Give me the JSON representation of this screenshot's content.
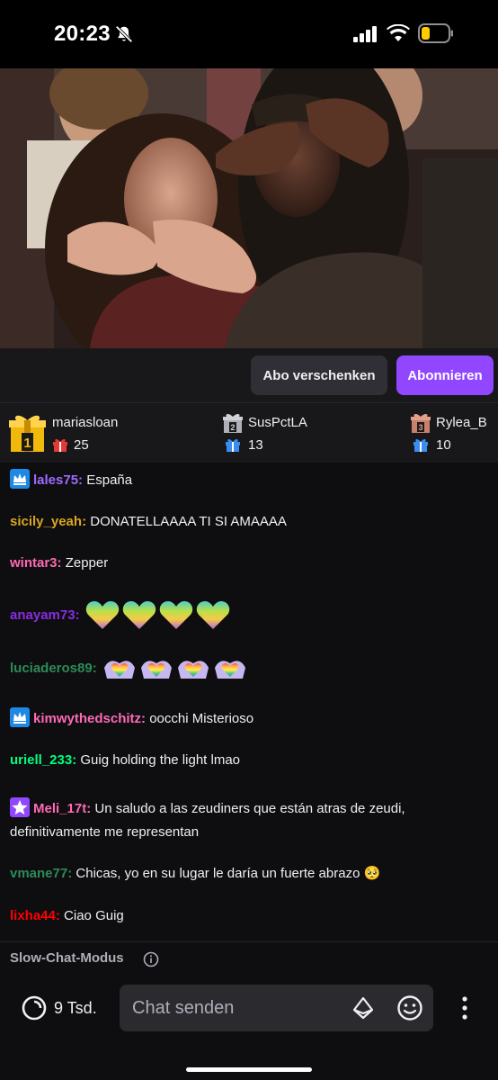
{
  "status_bar": {
    "time": "20:23",
    "icons": [
      "bell-off-icon",
      "signal-icon",
      "wifi-icon",
      "battery-low-icon"
    ],
    "battery_color": "#ffcc00"
  },
  "video": {
    "description_icon": "video-player"
  },
  "sub_bar": {
    "gift_label": "Abo verschenken",
    "subscribe_label": "Abonnieren",
    "accent": "#9147ff"
  },
  "leaderboard": [
    {
      "rank": "1",
      "name": "mariasloan",
      "count": "25"
    },
    {
      "rank": "2",
      "name": "SusPctLA",
      "count": "13"
    },
    {
      "rank": "3",
      "name": "Rylea_B",
      "count": "10"
    }
  ],
  "chat": [
    {
      "user": "lales75",
      "color": "#9d6bff",
      "badge": "crown",
      "text": "España",
      "suffix": ""
    },
    {
      "user": "sicily_yeah",
      "color": "#daa520",
      "badge": "",
      "text": "DONATELLAAAA TI SI AMAAAA",
      "suffix": ""
    },
    {
      "user": "wintar3",
      "color": "#ff69b4",
      "badge": "",
      "text": "Zepper",
      "suffix": ""
    },
    {
      "user": "anayam73",
      "color": "#8a2be2",
      "badge": "",
      "text": "",
      "suffix": ""
    },
    {
      "user": "luciaderos89",
      "color": "#2e8b57",
      "badge": "",
      "text": "",
      "suffix": ""
    },
    {
      "user": "kimwythedschitz",
      "color": "#ff69b4",
      "badge": "crown",
      "text": "oocchi Misterioso",
      "suffix": ""
    },
    {
      "user": "uriell_233",
      "color": "#00ff7f",
      "badge": "",
      "text": "Guig holding the light lmao",
      "suffix": ""
    },
    {
      "user": "Meli_17t",
      "color": "#ff69b4",
      "badge": "star",
      "text": "Un saludo a las zeudiners que están atras de zeudi, definitivamente me representan",
      "suffix": ""
    },
    {
      "user": "vmane77",
      "color": "#2e8b57",
      "badge": "",
      "text": "Chicas, yo en su lugar le daría un fuerte abrazo",
      "suffix": "🥺"
    },
    {
      "user": "lixha44",
      "color": "#ff0000",
      "badge": "",
      "text": "Ciao Guig",
      "suffix": ""
    }
  ],
  "slow_mode": {
    "label": "Slow-Chat-Modus"
  },
  "input_bar": {
    "points_label": "9 Tsd.",
    "placeholder": "Chat senden"
  }
}
